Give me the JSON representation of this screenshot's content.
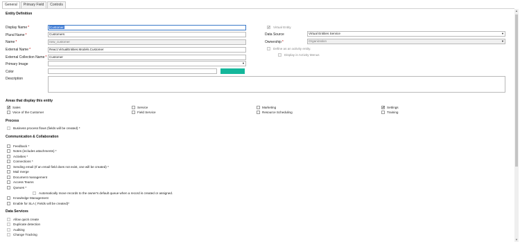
{
  "tabs": [
    "General",
    "Primary Field",
    "Controls"
  ],
  "entity_definition": {
    "title": "Entity Definition",
    "display_name_label": "Display Name",
    "display_name_value": "Customer",
    "plural_name_label": "Plural Name",
    "plural_name_value": "Customers",
    "name_label": "Name",
    "name_value": "new_customer",
    "external_name_label": "External Name",
    "external_name_value": "React.VirtualEntities.Models.Customer",
    "external_collection_label": "External Collection Name",
    "external_collection_value": "Customer",
    "primary_image_label": "Primary Image",
    "color_label": "Color",
    "color_value": "#14b79b",
    "description_label": "Description",
    "virtual_entity_label": "Virtual Entity",
    "data_source_label": "Data Source",
    "data_source_value": "Virtual Entities Service",
    "ownership_label": "Ownership",
    "ownership_value": "Organization",
    "define_activity_label": "Define as an activity entity.",
    "display_activity_menus_label": "Display in Activity Menus"
  },
  "areas": {
    "title": "Areas that display this entity",
    "items": [
      {
        "label": "Sales",
        "checked": true
      },
      {
        "label": "Service",
        "checked": false
      },
      {
        "label": "Marketing",
        "checked": false
      },
      {
        "label": "Settings",
        "checked": true
      },
      {
        "label": "Voice of the Customer",
        "checked": false
      },
      {
        "label": "Field Service",
        "checked": false
      },
      {
        "label": "Resource Scheduling",
        "checked": false
      },
      {
        "label": "Training",
        "checked": false
      }
    ]
  },
  "process": {
    "title": "Process",
    "bpf_label": "Business process flows (fields will be created) *"
  },
  "communication": {
    "title": "Communication & Collaboration",
    "items": [
      "Feedback *",
      "Notes (includes attachments) *",
      "Activities *",
      "Connections *",
      "Sending email (If an email field does not exist, one will be created) *",
      "Mail merge",
      "Document management",
      "Access Teams",
      "Queues *"
    ],
    "auto_move_label": "Automatically move records to the owner's default queue when a record is created or assigned.",
    "knowledge_label": "Knowledge Management",
    "sla_label": "Enable for SLA ( Fields will be created)*"
  },
  "data_services": {
    "title": "Data Services",
    "items": [
      "Allow quick create",
      "Duplicate detection",
      "Auditing",
      "Change Tracking"
    ]
  },
  "required_mark": "*",
  "checkmark": "✔",
  "dropdown_caret": "▼",
  "scroll_up": "▲",
  "scroll_down": "▼"
}
